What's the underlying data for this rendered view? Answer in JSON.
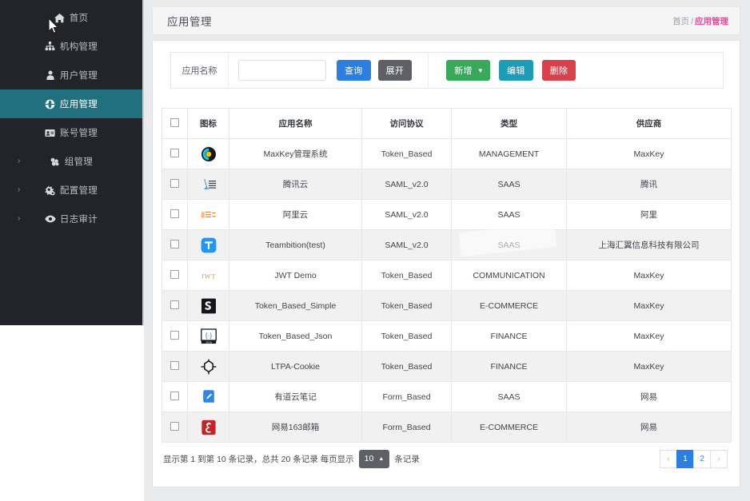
{
  "sidebar": {
    "items": [
      {
        "label": "首页",
        "icon": "home-icon",
        "active": false,
        "expandable": false
      },
      {
        "label": "机构管理",
        "icon": "sitemap-icon",
        "active": false,
        "expandable": false
      },
      {
        "label": "用户管理",
        "icon": "user-icon",
        "active": false,
        "expandable": false
      },
      {
        "label": "应用管理",
        "icon": "globe-icon",
        "active": true,
        "expandable": false
      },
      {
        "label": "账号管理",
        "icon": "idcard-icon",
        "active": false,
        "expandable": false
      },
      {
        "label": "组管理",
        "icon": "cubes-icon",
        "active": false,
        "expandable": true
      },
      {
        "label": "配置管理",
        "icon": "gears-icon",
        "active": false,
        "expandable": true
      },
      {
        "label": "日志审计",
        "icon": "eye-icon",
        "active": false,
        "expandable": true
      }
    ],
    "caret_glyph": "›",
    "active_color": "#21707f",
    "background": "#222429"
  },
  "header": {
    "title": "应用管理",
    "breadcrumb_home": "首页",
    "breadcrumb_sep": "/",
    "breadcrumb_current": "应用管理",
    "breadcrumb_current_color": "#e0519a"
  },
  "toolbar": {
    "search_label": "应用名称",
    "search_value": "",
    "search_placeholder": "",
    "query_label": "查询",
    "expand_label": "展开",
    "add_label": "新增",
    "add_caret": "▼",
    "edit_label": "编辑",
    "delete_label": "删除",
    "colors": {
      "query": "#2a7fe0",
      "expand": "#5d6166",
      "add": "#38a95a",
      "edit": "#1f9cb5",
      "delete": "#d8414c"
    }
  },
  "table": {
    "columns": [
      "",
      "图标",
      "应用名称",
      "访问协议",
      "类型",
      "供应商"
    ],
    "rows": [
      {
        "icon": "maxkey-icon",
        "name": "MaxKey管理系统",
        "protocol": "Token_Based",
        "type": "MANAGEMENT",
        "vendor": "MaxKey"
      },
      {
        "icon": "tencent-icon",
        "name": "腾讯云",
        "protocol": "SAML_v2.0",
        "type": "SAAS",
        "vendor": "腾讯"
      },
      {
        "icon": "aliyun-icon",
        "name": "阿里云",
        "protocol": "SAML_v2.0",
        "type": "SAAS",
        "vendor": "阿里"
      },
      {
        "icon": "teambition-icon",
        "name": "Teambition(test)",
        "protocol": "SAML_v2.0",
        "type": "SAAS",
        "vendor": "上海汇翼信息科技有限公司"
      },
      {
        "icon": "jwt-icon",
        "name": "JWT Demo",
        "protocol": "Token_Based",
        "type": "COMMUNICATION",
        "vendor": "MaxKey"
      },
      {
        "icon": "simple-icon",
        "name": "Token_Based_Simple",
        "protocol": "Token_Based",
        "type": "E-COMMERCE",
        "vendor": "MaxKey"
      },
      {
        "icon": "json-icon",
        "name": "Token_Based_Json",
        "protocol": "Token_Based",
        "type": "FINANCE",
        "vendor": "MaxKey"
      },
      {
        "icon": "ltpa-icon",
        "name": "LTPA-Cookie",
        "protocol": "Token_Based",
        "type": "FINANCE",
        "vendor": "MaxKey"
      },
      {
        "icon": "youdao-icon",
        "name": "有道云笔记",
        "protocol": "Form_Based",
        "type": "SAAS",
        "vendor": "网易"
      },
      {
        "icon": "netease-icon",
        "name": "网易163邮箱",
        "protocol": "Form_Based",
        "type": "E-COMMERCE",
        "vendor": "网易"
      }
    ]
  },
  "footer": {
    "summary_prefix": "显示第 1 到第 10 条记录，总共 20 条记录 每页显示",
    "page_size": "10",
    "page_size_caret": "▲",
    "summary_suffix": "条记录",
    "pager": {
      "prev": "‹",
      "pages": [
        "1",
        "2"
      ],
      "active_page": "1",
      "next": "›"
    }
  }
}
